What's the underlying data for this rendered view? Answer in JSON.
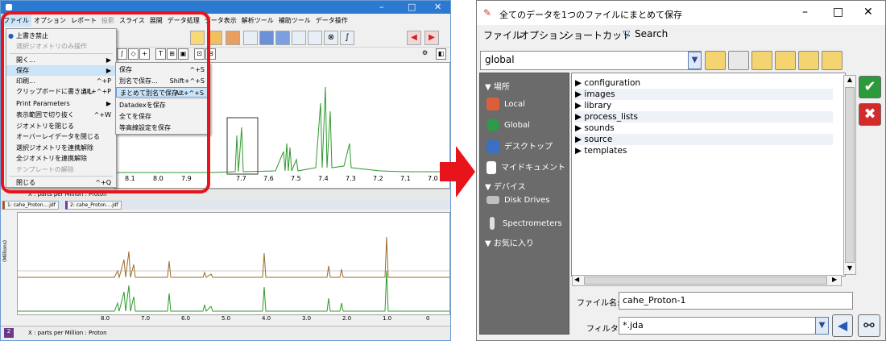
{
  "left": {
    "menubar": [
      "ファイル",
      "オプション",
      "レポート",
      "投影",
      "スライス",
      "展開",
      "データ処理",
      "データ表示",
      "解析ツール",
      "補助ツール",
      "データ操作"
    ],
    "file_menu": [
      {
        "label": "上書き禁止",
        "shortcut": "",
        "state": "checked"
      },
      {
        "label": "選択ジオメトリのみ操作",
        "shortcut": "",
        "state": "disabled"
      },
      {
        "label": "開く...",
        "shortcut": "▶",
        "state": ""
      },
      {
        "label": "保存",
        "shortcut": "▶",
        "state": "highlight"
      },
      {
        "label": "印刷...",
        "shortcut": "^+P",
        "state": ""
      },
      {
        "label": "クリップボードに書き出し",
        "shortcut": "Alt+^+P",
        "state": ""
      },
      {
        "label": "Print Parameters",
        "shortcut": "▶",
        "state": ""
      },
      {
        "label": "表示範囲で切り抜く",
        "shortcut": "^+W",
        "state": ""
      },
      {
        "label": "ジオメトリを閉じる",
        "shortcut": "",
        "state": ""
      },
      {
        "label": "オーバーレイデータを閉じる",
        "shortcut": "",
        "state": ""
      },
      {
        "label": "選択ジオメトリを連携解除",
        "shortcut": "",
        "state": ""
      },
      {
        "label": "全ジオメトリを連携解除",
        "shortcut": "",
        "state": ""
      },
      {
        "label": "テンプレートの解除",
        "shortcut": "",
        "state": "disabled"
      },
      {
        "label": "閉じる",
        "shortcut": "^+Q",
        "state": ""
      }
    ],
    "save_submenu": [
      {
        "label": "保存",
        "shortcut": "^+S"
      },
      {
        "label": "別名で保存...",
        "shortcut": "Shift+^+S"
      },
      {
        "label": "まとめて別名で保存...",
        "shortcut": "Alt+^+S"
      },
      {
        "label": "Datadexを保存",
        "shortcut": ""
      },
      {
        "label": "全てを保存",
        "shortcut": ""
      },
      {
        "label": "等高線設定を保存",
        "shortcut": ""
      }
    ],
    "axis1_ticks": [
      "8.1",
      "8.0",
      "7.9",
      "7.7",
      "7.6",
      "7.5",
      "7.4",
      "7.3",
      "7.2",
      "7.1",
      "7.0"
    ],
    "status1": "X : parts per Million : Proton",
    "tabs": [
      "1: cahe_Proton....jdf",
      "2: cahe_Proton....jdf"
    ],
    "axis2_ticks": [
      "8.0",
      "7.0",
      "6.0",
      "5.0",
      "4.0",
      "3.0",
      "2.0",
      "1.0",
      "0"
    ],
    "y_label": "(Millions)",
    "status2": "X : parts per Million : Proton",
    "page_num": "2"
  },
  "dialog": {
    "title": "全てのデータを1つのファイルにまとめて保存",
    "menu": [
      "ファイル",
      "オプション",
      "ショートカット",
      "Search"
    ],
    "path": "global",
    "places_header": "場所",
    "places": [
      {
        "label": "Local",
        "icon": "home-icon",
        "color": "#d9603a"
      },
      {
        "label": "Global",
        "icon": "globe-icon",
        "color": "#2e9a4a"
      },
      {
        "label": "デスクトップ",
        "icon": "desktop-icon",
        "color": "#3a6fc4"
      },
      {
        "label": "マイドキュメント",
        "icon": "document-icon",
        "color": "#ffffff"
      }
    ],
    "devices_header": "デバイス",
    "devices": [
      {
        "label": "Disk Drives",
        "icon": "disk-icon",
        "color": "#c0c0c0"
      },
      {
        "label": "Spectrometers",
        "icon": "spectrometer-icon",
        "color": "#e0e0e0"
      }
    ],
    "favorites_header": "お気に入り",
    "files": [
      "configuration",
      "images",
      "library",
      "process_lists",
      "sounds",
      "source",
      "templates"
    ],
    "filename_label": "ファイル名:",
    "filename_value": "cahe_Proton-1",
    "filter_label": "フィルタ:",
    "filter_value": "*.jda"
  },
  "colors": {
    "accent": "#2b79d0",
    "highlight_box": "#e8141c",
    "ok": "#2a9a3a",
    "cancel": "#d42a2a"
  }
}
